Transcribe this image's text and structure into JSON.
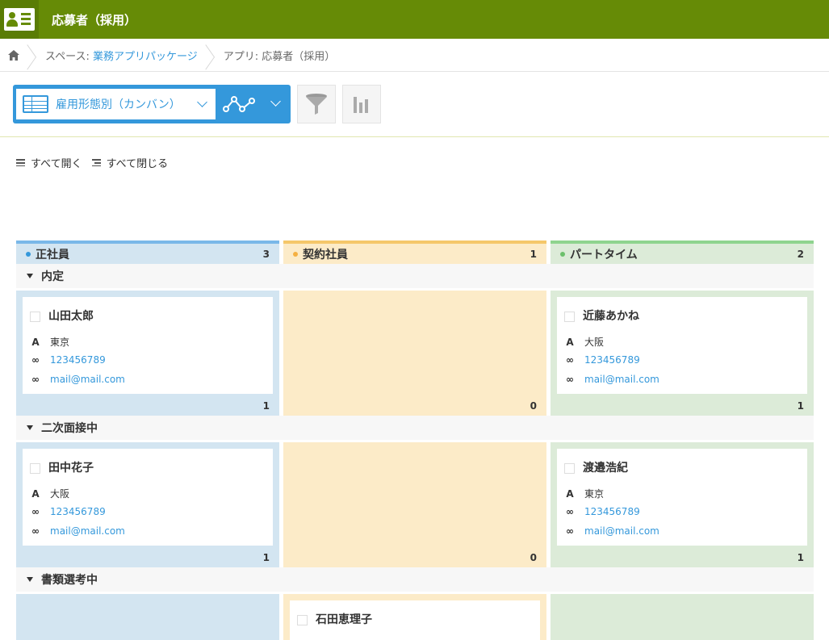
{
  "header": {
    "title": "応募者（採用）"
  },
  "breadcrumb": {
    "space_prefix": "スペース: ",
    "space_name": "業務アプリパッケージ",
    "app_prefix": "アプリ: ",
    "app_name": "応募者（採用）"
  },
  "toolbar": {
    "view_label": "雇用形態別（カンバン）"
  },
  "expand": {
    "open_all": "すべて開く",
    "close_all": "すべて閉じる"
  },
  "colors": {
    "header": "#668b06",
    "accent": "#3498db"
  },
  "columns": [
    {
      "label": "正社員",
      "count": "3",
      "color": "#7ab8e8",
      "bg": "#d3e5f1"
    },
    {
      "label": "契約社員",
      "count": "1",
      "color": "#f5c76a",
      "bg": "#fcebc8"
    },
    {
      "label": "パートタイム",
      "count": "2",
      "color": "#8fd48f",
      "bg": "#dcebd8"
    }
  ],
  "groups": [
    {
      "label": "内定"
    },
    {
      "label": "二次面接中"
    },
    {
      "label": "書類選考中"
    }
  ],
  "cells": {
    "g0": {
      "c0_count": "1",
      "c1_count": "0",
      "c2_count": "1"
    },
    "g1": {
      "c0_count": "1",
      "c1_count": "0",
      "c2_count": "1"
    }
  },
  "cards": [
    {
      "name": "山田太郎",
      "location": "東京",
      "phone": "123456789",
      "email": "mail@mail.com"
    },
    {
      "name": "近藤あかね",
      "location": "大阪",
      "phone": "123456789",
      "email": "mail@mail.com"
    },
    {
      "name": "田中花子",
      "location": "大阪",
      "phone": "123456789",
      "email": "mail@mail.com"
    },
    {
      "name": "渡邉浩紀",
      "location": "東京",
      "phone": "123456789",
      "email": "mail@mail.com"
    },
    {
      "name": "石田恵理子"
    }
  ]
}
